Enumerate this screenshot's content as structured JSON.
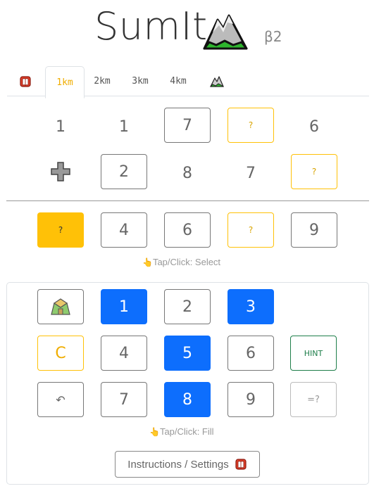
{
  "header": {
    "title": "SumIt",
    "version": "β2",
    "logo_icon": "mountain-icon"
  },
  "tabs": [
    {
      "label": "",
      "icon": "book-icon"
    },
    {
      "label": "1km",
      "active": true
    },
    {
      "label": "2km"
    },
    {
      "label": "3km"
    },
    {
      "label": "4km"
    },
    {
      "label": "",
      "icon": "mountain-icon"
    }
  ],
  "puzzle": {
    "row1": [
      "1",
      "1",
      "7",
      "?",
      "6"
    ],
    "operator": "plus-icon",
    "row2": [
      "2",
      "8",
      "7",
      "?"
    ],
    "result": [
      "?",
      "4",
      "6",
      "?",
      "9"
    ],
    "select_hint": "Tap/Click: Select"
  },
  "keypad": {
    "row1": [
      "1",
      "2",
      "3"
    ],
    "row2": [
      "C",
      "4",
      "5",
      "6",
      "HINT"
    ],
    "row3": [
      "7",
      "8",
      "9",
      "=?"
    ],
    "fill_hint": "Tap/Click: Fill",
    "instructions_label": "Instructions / Settings"
  },
  "colors": {
    "accent_gold": "#ffc107",
    "accent_blue": "#0d6efd",
    "hint_green": "#1e7e4a"
  }
}
